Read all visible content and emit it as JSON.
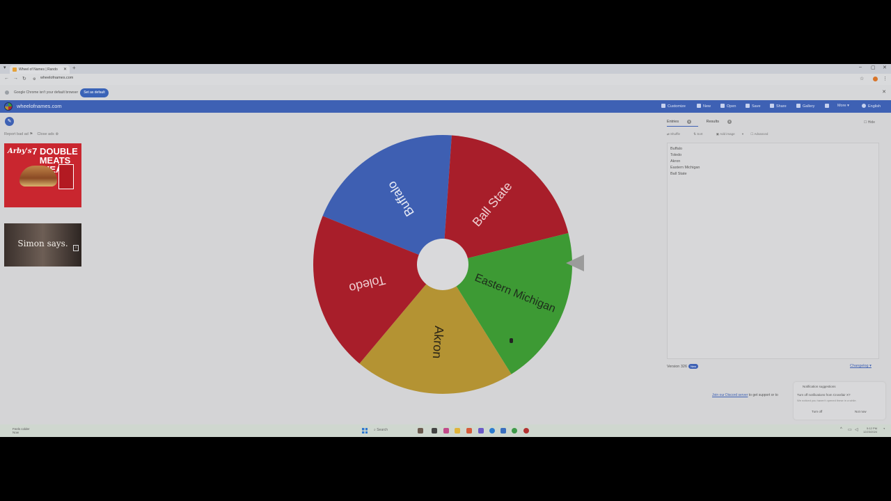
{
  "browser": {
    "tab_title": "Wheel of Names | Random",
    "url": "wheelofnames.com",
    "infobar_text": "Google Chrome isn't your default browser",
    "set_default_label": "Set as default"
  },
  "app": {
    "site_name": "wheelofnames.com",
    "menu": [
      "Customize",
      "New",
      "Open",
      "Save",
      "Share",
      "Gallery",
      "More",
      "English"
    ]
  },
  "ads": {
    "report_label": "Report bad ad",
    "close_label": "Close ads",
    "ad1_brand": "Arby's",
    "ad1_headline": "7 DOUBLE MEATS MEAL",
    "ad2_caption": "Simon says."
  },
  "wheel": {
    "entries": [
      {
        "label": "Buffalo",
        "color": "#3e5fb2",
        "text_color": "#e8ecf6"
      },
      {
        "label": "Ball State",
        "color": "#a81e2a",
        "text_color": "#eecfd2"
      },
      {
        "label": "Eastern Michigan",
        "color": "#3d9a34",
        "text_color": "#1d2b1b"
      },
      {
        "label": "Akron",
        "color": "#b49333",
        "text_color": "#2a2416"
      },
      {
        "label": "Toledo",
        "color": "#a81e2a",
        "text_color": "#eecfd2"
      }
    ]
  },
  "panel": {
    "tabs": [
      {
        "label": "Entries",
        "count": "5"
      },
      {
        "label": "Results",
        "count": "0"
      }
    ],
    "hide_label": "Hide",
    "tools": [
      "Shuffle",
      "Sort",
      "Add image",
      "Advanced"
    ],
    "entries_text": [
      "Buffalo",
      "Toledo",
      "Akron",
      "Eastern Michigan",
      "Ball State"
    ],
    "version": "Version 326",
    "new_badge": "New",
    "changelog": "Changelog",
    "discord_link": "Join our Discord server",
    "discord_rest": " to get support or to"
  },
  "notification": {
    "title": "Notification suggestions",
    "heading": "Turn off notifications from Crossfair X?",
    "sub": "We noticed you haven't opened these in a while.",
    "turn_off": "Turn off",
    "not_now": "Not now"
  },
  "taskbar": {
    "weather_line1": "Feels colder",
    "weather_line2": "Now",
    "search": "Search",
    "time": "5:12 PM",
    "date": "12/23/2024"
  }
}
